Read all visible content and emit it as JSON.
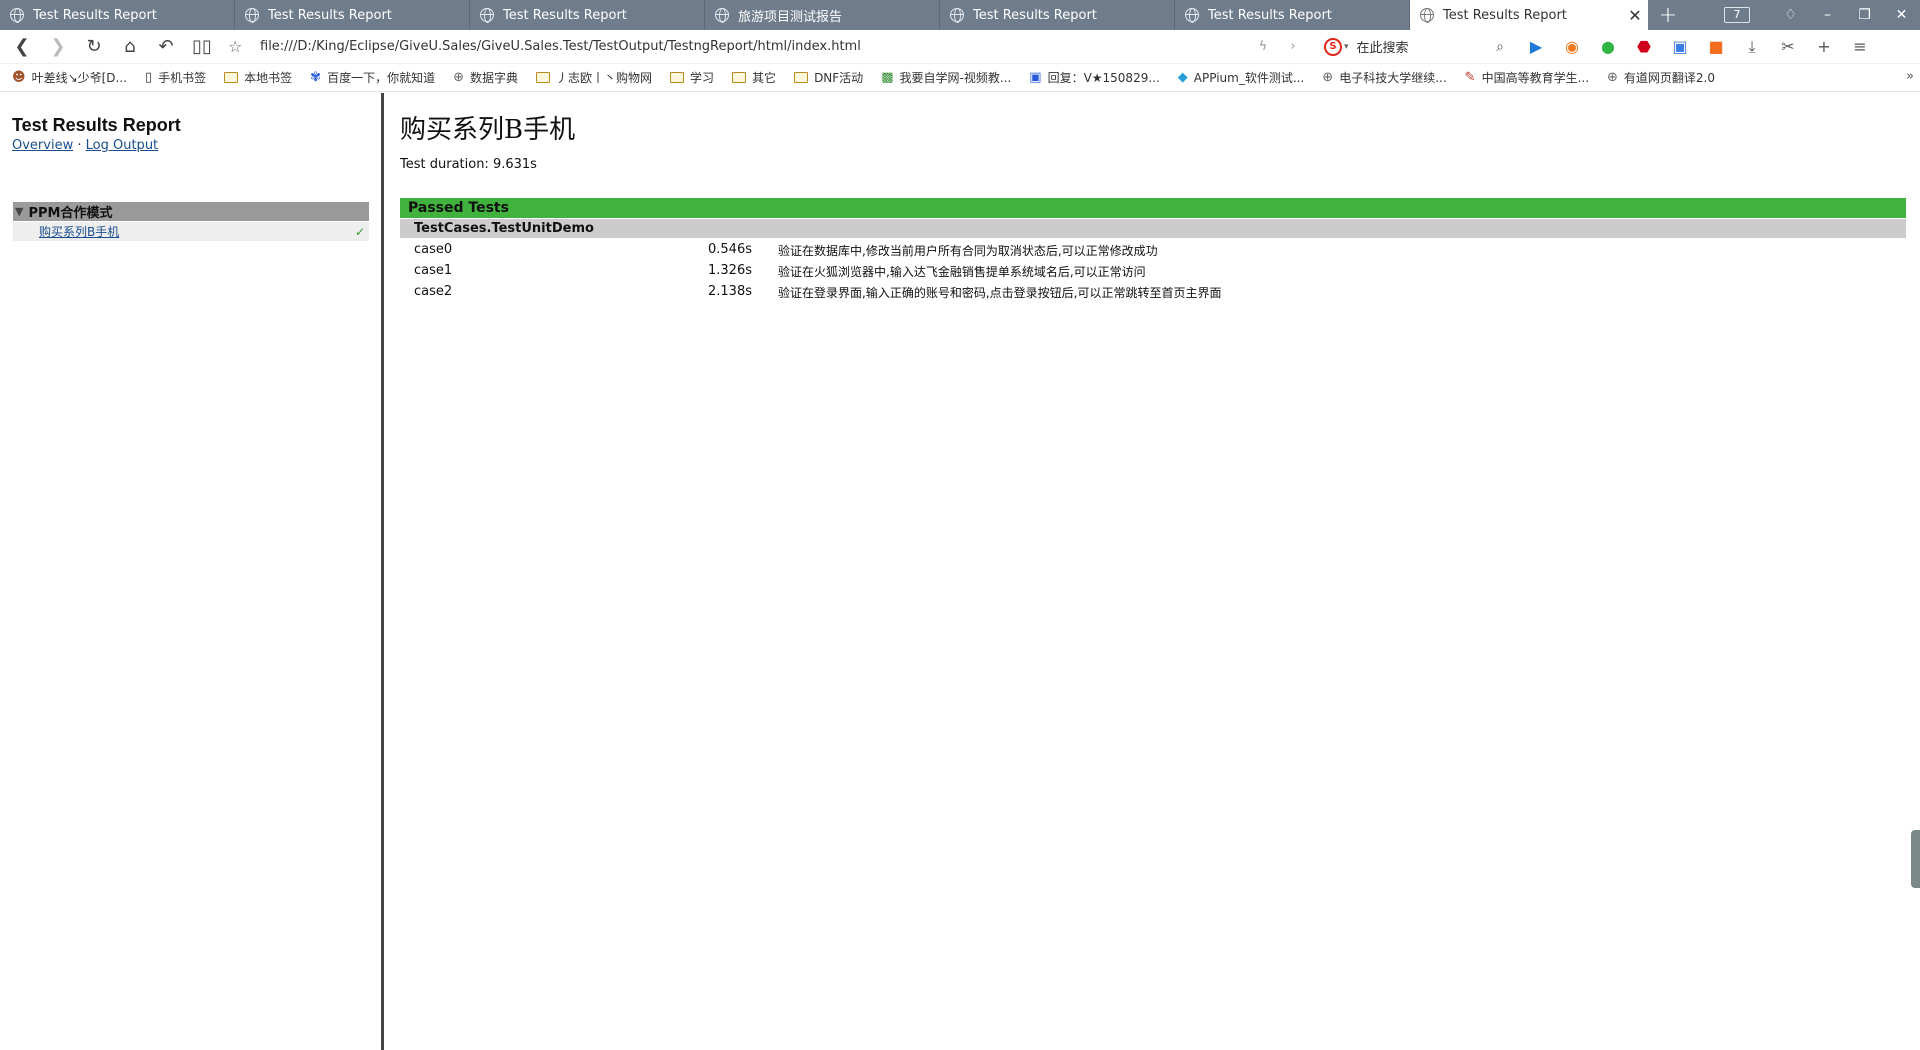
{
  "tabs": [
    {
      "label": "Test Results Report",
      "active": false
    },
    {
      "label": "Test Results Report",
      "active": false
    },
    {
      "label": "Test Results Report",
      "active": false
    },
    {
      "label": "旅游项目测试报告",
      "active": false
    },
    {
      "label": "Test Results Report",
      "active": false
    },
    {
      "label": "Test Results Report",
      "active": false
    },
    {
      "label": "Test Results Report",
      "active": true
    }
  ],
  "tab_count": "7",
  "address": {
    "url": "file:///D:/King/Eclipse/GiveU.Sales/GiveU.Sales.Test/TestOutput/TestngReport/html/index.html",
    "search_placeholder": "在此搜索"
  },
  "bookmarks": [
    {
      "label": "叶差线↘少爷[D...",
      "icon": "avatar-icon"
    },
    {
      "label": "手机书签",
      "icon": "phone-icon"
    },
    {
      "label": "本地书签",
      "icon": "folder-icon"
    },
    {
      "label": "百度一下，你就知道",
      "icon": "baidu-icon"
    },
    {
      "label": "数据字典",
      "icon": "globe-icon"
    },
    {
      "label": "丿志欧丨丶购物网",
      "icon": "folder-icon"
    },
    {
      "label": "学习",
      "icon": "folder-icon"
    },
    {
      "label": "其它",
      "icon": "folder-icon"
    },
    {
      "label": "DNF活动",
      "icon": "folder-icon"
    },
    {
      "label": "我要自学网-视频教...",
      "icon": "zxw-icon"
    },
    {
      "label": "回复：V★150829...",
      "icon": "reply-icon"
    },
    {
      "label": "APPium_软件测试...",
      "icon": "diamond-icon"
    },
    {
      "label": "电子科技大学继续...",
      "icon": "globe-icon"
    },
    {
      "label": "中国高等教育学生...",
      "icon": "pen-icon"
    },
    {
      "label": "有道网页翻译2.0",
      "icon": "globe-icon"
    }
  ],
  "sidebar": {
    "title": "Test Results Report",
    "overview_link": "Overview",
    "separator": "·",
    "log_link": "Log Output",
    "suite": "PPM合作模式",
    "test": "购买系列B手机",
    "test_status": "✓"
  },
  "main": {
    "title": "购买系列B手机",
    "duration": "Test duration: 9.631s",
    "passed_header": "Passed Tests",
    "class_name": "TestCases.TestUnitDemo",
    "cases": [
      {
        "name": "case0",
        "duration": "0.546s",
        "description": "验证在数据库中,修改当前用户所有合同为取消状态后,可以正常修改成功"
      },
      {
        "name": "case1",
        "duration": "1.326s",
        "description": "验证在火狐浏览器中,输入达飞金融销售提单系统域名后,可以正常访问"
      },
      {
        "name": "case2",
        "duration": "2.138s",
        "description": "验证在登录界面,输入正确的账号和密码,点击登录按钮后,可以正常跳转至首页主界面"
      }
    ]
  },
  "colors": {
    "tab_strip": "#6f7c8b",
    "passed_green": "#42b23e",
    "class_gray": "#cccccc",
    "suite_gray": "#9a9a9a",
    "link_blue": "#1a4d8f"
  }
}
